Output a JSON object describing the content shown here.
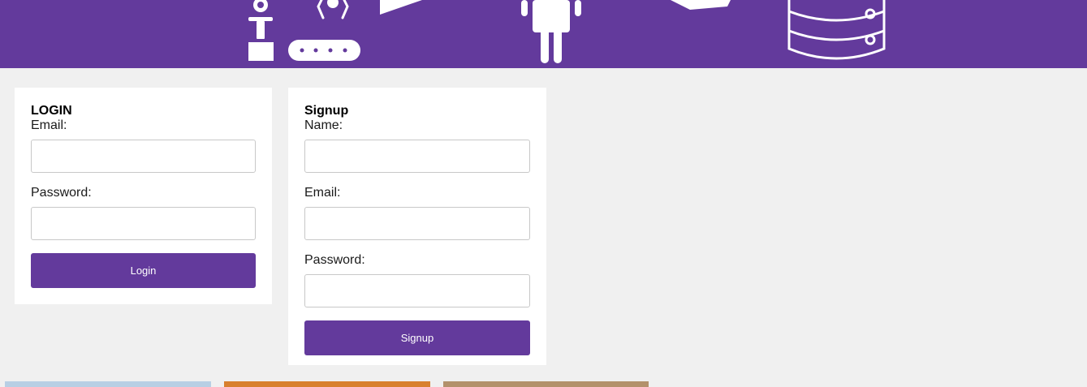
{
  "banner": {
    "background": "#633a9c",
    "icons": [
      "robot-arm-icon",
      "conveyor-belt-icon",
      "paper-plane-icon",
      "person-icon",
      "arrow-icon",
      "database-icon"
    ]
  },
  "login": {
    "title": "LOGIN",
    "email_label": "Email:",
    "password_label": "Password:",
    "button_label": "Login"
  },
  "signup": {
    "title": "Signup",
    "name_label": "Name:",
    "email_label": "Email:",
    "password_label": "Password:",
    "button_label": "Signup"
  },
  "thumbnails": {
    "colors": [
      "#b8cfe4",
      "#d8802e",
      "#b3916b"
    ]
  },
  "colors": {
    "accent": "#633a9c",
    "page_bg": "#f0f0f0"
  }
}
